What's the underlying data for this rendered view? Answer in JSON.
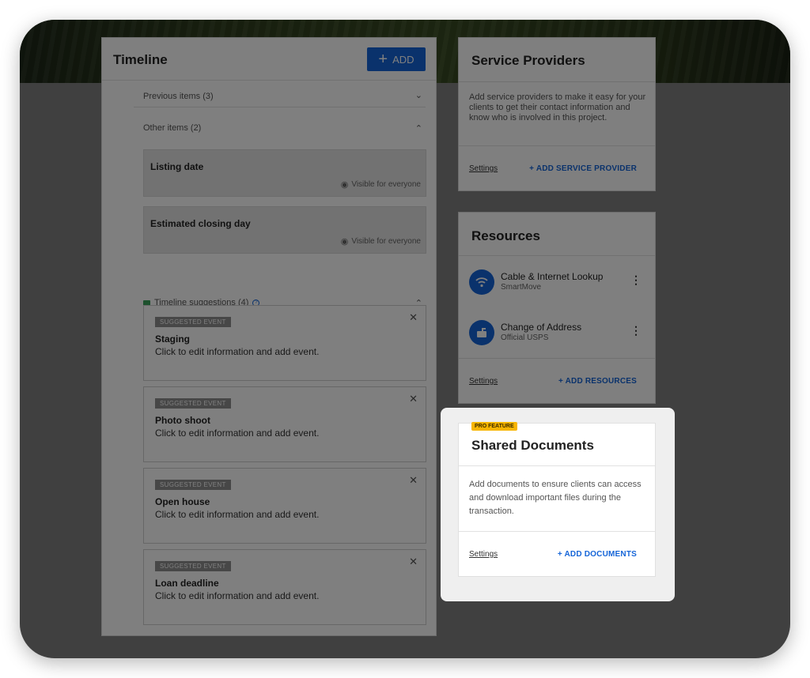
{
  "timeline": {
    "title": "Timeline",
    "add_label": "ADD",
    "previous_label": "Previous items (3)",
    "other_label": "Other items (2)",
    "items": [
      {
        "title": "Listing date",
        "visibility": "Visible for everyone"
      },
      {
        "title": "Estimated closing day",
        "visibility": "Visible for everyone"
      }
    ],
    "suggestions_label": "Timeline suggestions (4)",
    "suggestions": [
      {
        "badge": "SUGGESTED EVENT",
        "title": "Staging",
        "desc": "Click to edit information and add event."
      },
      {
        "badge": "SUGGESTED EVENT",
        "title": "Photo shoot",
        "desc": "Click to edit information and add event."
      },
      {
        "badge": "SUGGESTED EVENT",
        "title": "Open house",
        "desc": "Click to edit information and add event."
      },
      {
        "badge": "SUGGESTED EVENT",
        "title": "Loan deadline",
        "desc": "Click to edit information and add event."
      }
    ]
  },
  "service_providers": {
    "title": "Service Providers",
    "desc": "Add service providers to make it easy for your clients to get their contact information and know who is involved in this project.",
    "settings": "Settings",
    "add": "+ ADD SERVICE PROVIDER"
  },
  "resources": {
    "title": "Resources",
    "items": [
      {
        "name": "Cable & Internet Lookup",
        "sub": "SmartMove",
        "icon": "wifi-icon"
      },
      {
        "name": "Change of Address",
        "sub": "Official USPS",
        "icon": "mailbox-icon"
      }
    ],
    "settings": "Settings",
    "add": "+ ADD RESOURCES"
  },
  "shared_documents": {
    "pro_badge": "PRO FEATURE",
    "title": "Shared Documents",
    "desc": "Add documents to ensure clients can access and download important files during the transaction.",
    "settings": "Settings",
    "add": "+ ADD DOCUMENTS"
  },
  "colors": {
    "accent": "#1565d8",
    "pro": "#f7b500",
    "suggest_icon": "#3aa35a"
  }
}
